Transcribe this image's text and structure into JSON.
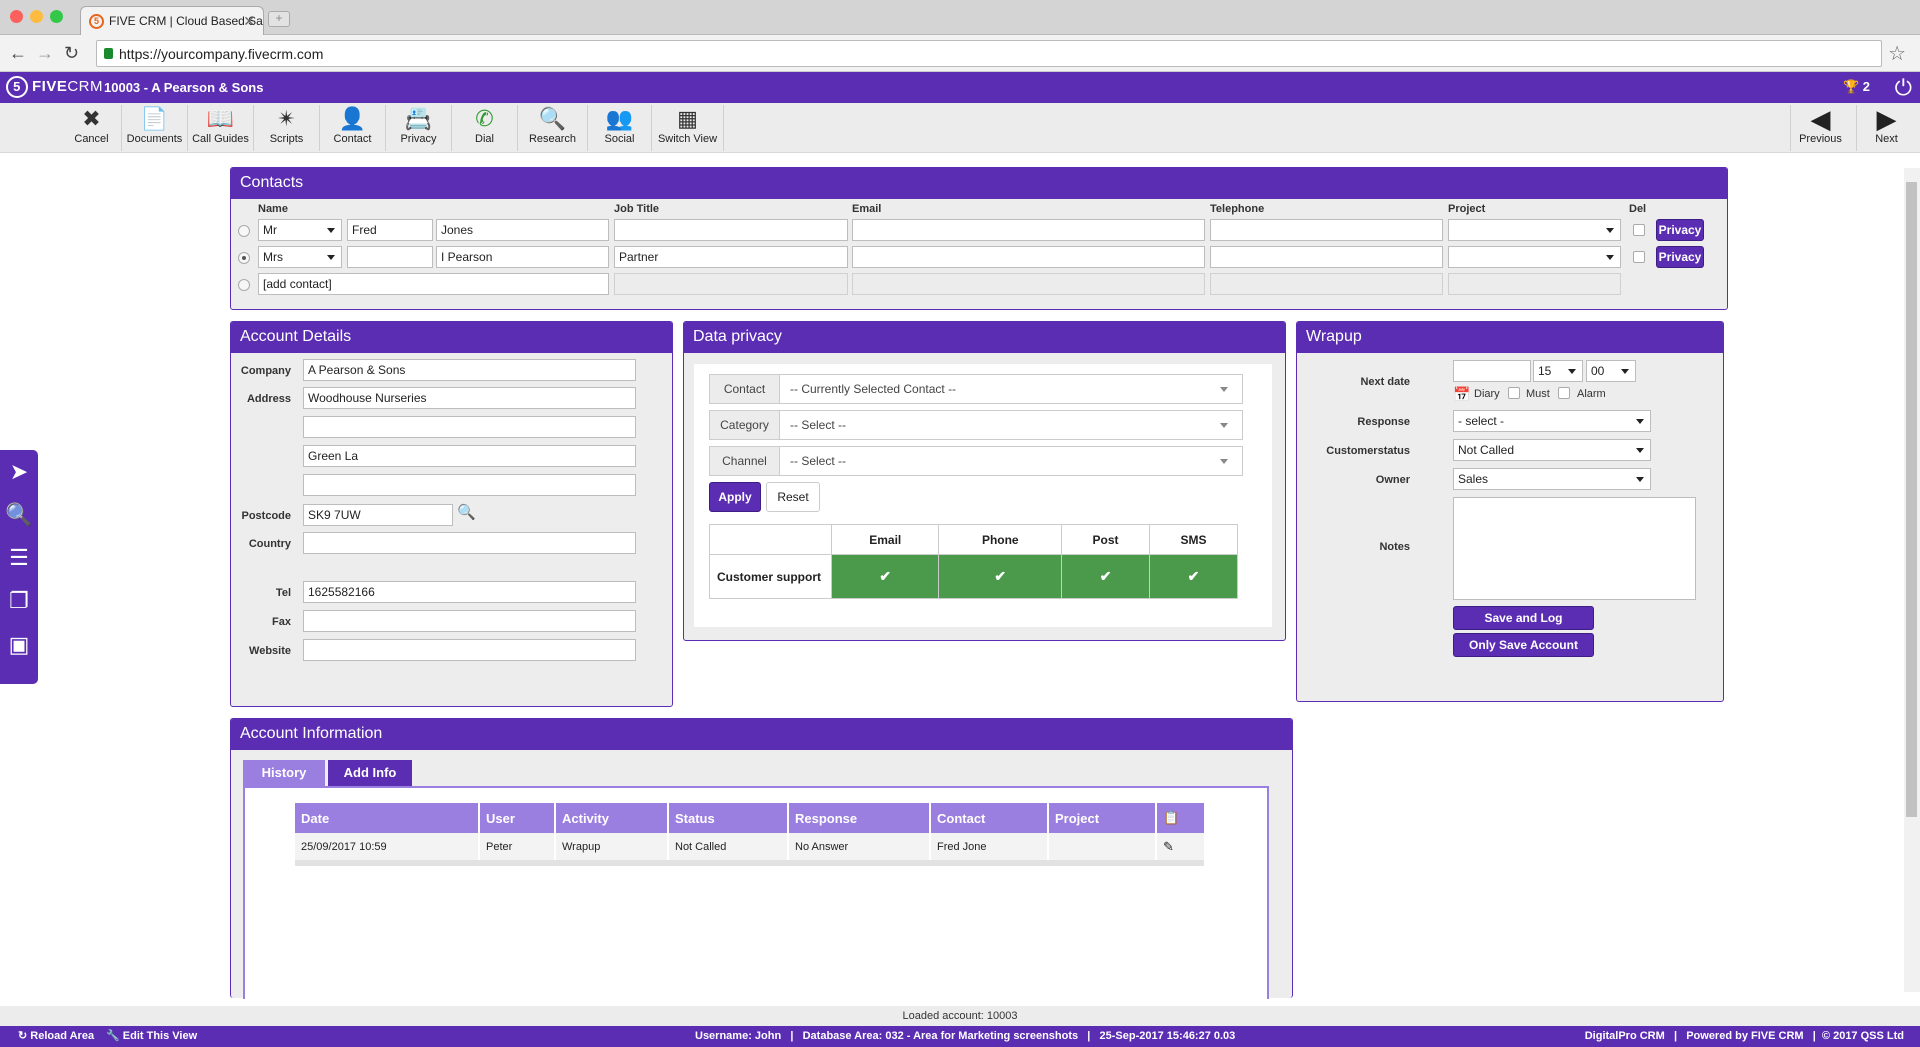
{
  "browser": {
    "tab_title": "FIVE CRM | Cloud Based Sa",
    "url": "https://yourcompany.fivecrm.com"
  },
  "header": {
    "logo_five": "FIVE",
    "logo_crm": "CRM",
    "account_title": "10003 - A Pearson & Sons",
    "trophy_count": "2"
  },
  "toolbar": {
    "items": [
      "Cancel",
      "Documents",
      "Call Guides",
      "Scripts",
      "Contact",
      "Privacy",
      "Dial",
      "Research",
      "Social",
      "Switch View"
    ],
    "previous": "Previous",
    "next": "Next"
  },
  "contacts": {
    "title": "Contacts",
    "headers": {
      "name": "Name",
      "job": "Job Title",
      "email": "Email",
      "tel": "Telephone",
      "project": "Project",
      "del": "Del"
    },
    "rows": [
      {
        "title": "Mr",
        "first": "Fred",
        "last": "Jones",
        "job": "",
        "email": "",
        "tel": "",
        "project": ""
      },
      {
        "title": "Mrs",
        "first": "",
        "last": "I Pearson",
        "job": "Partner",
        "email": "",
        "tel": "",
        "project": ""
      }
    ],
    "privacy_label": "Privacy",
    "add_contact": "[add contact]"
  },
  "account": {
    "title": "Account Details",
    "labels": {
      "company": "Company",
      "address": "Address",
      "postcode": "Postcode",
      "country": "Country",
      "tel": "Tel",
      "fax": "Fax",
      "website": "Website"
    },
    "company": "A Pearson & Sons",
    "address1": "Woodhouse Nurseries",
    "address2": "",
    "address3": "Green La",
    "address4": "",
    "postcode": "SK9 7UW",
    "country": "",
    "tel": "1625582166",
    "fax": "",
    "website": ""
  },
  "privacy": {
    "title": "Data privacy",
    "contact_label": "Contact",
    "contact_value": "-- Currently Selected Contact --",
    "category_label": "Category",
    "category_value": "-- Select --",
    "channel_label": "Channel",
    "channel_value": "-- Select --",
    "apply": "Apply",
    "reset": "Reset",
    "columns": [
      "Email",
      "Phone",
      "Post",
      "SMS"
    ],
    "row_label": "Customer support"
  },
  "wrapup": {
    "title": "Wrapup",
    "labels": {
      "next_date": "Next date",
      "response": "Response",
      "customerstatus": "Customerstatus",
      "owner": "Owner",
      "notes": "Notes"
    },
    "next_date": "",
    "hour": "15",
    "minute": "00",
    "diary": "Diary",
    "must": "Must",
    "alarm": "Alarm",
    "response": "- select -",
    "customerstatus": "Not Called",
    "owner": "Sales",
    "save_log": "Save and Log",
    "only_save": "Only Save Account"
  },
  "info": {
    "title": "Account Information",
    "tabs": [
      "History",
      "Add Info"
    ],
    "columns": [
      "Date",
      "User",
      "Activity",
      "Status",
      "Response",
      "Contact",
      "Project"
    ],
    "rows": [
      {
        "date": "25/09/2017 10:59",
        "user": "Peter",
        "activity": "Wrapup",
        "status": "Not Called",
        "response": "No Answer",
        "contact": "Fred Jone",
        "project": ""
      }
    ]
  },
  "footer": {
    "loaded": "Loaded account: 10003",
    "reload": "Reload Area",
    "edit_view": "Edit This View",
    "center": "Username: John   |   Database Area: 032 - Area for Marketing screenshots   |   25-Sep-2017 15:46:27 0.03",
    "right": "DigitalPro CRM   |   Powered by FIVE CRM   |  © 2017 QSS Ltd"
  },
  "colors": {
    "brand": "#5a2db2",
    "ok_green": "#4b9a4b",
    "tab_light": "#9a7ee0"
  }
}
